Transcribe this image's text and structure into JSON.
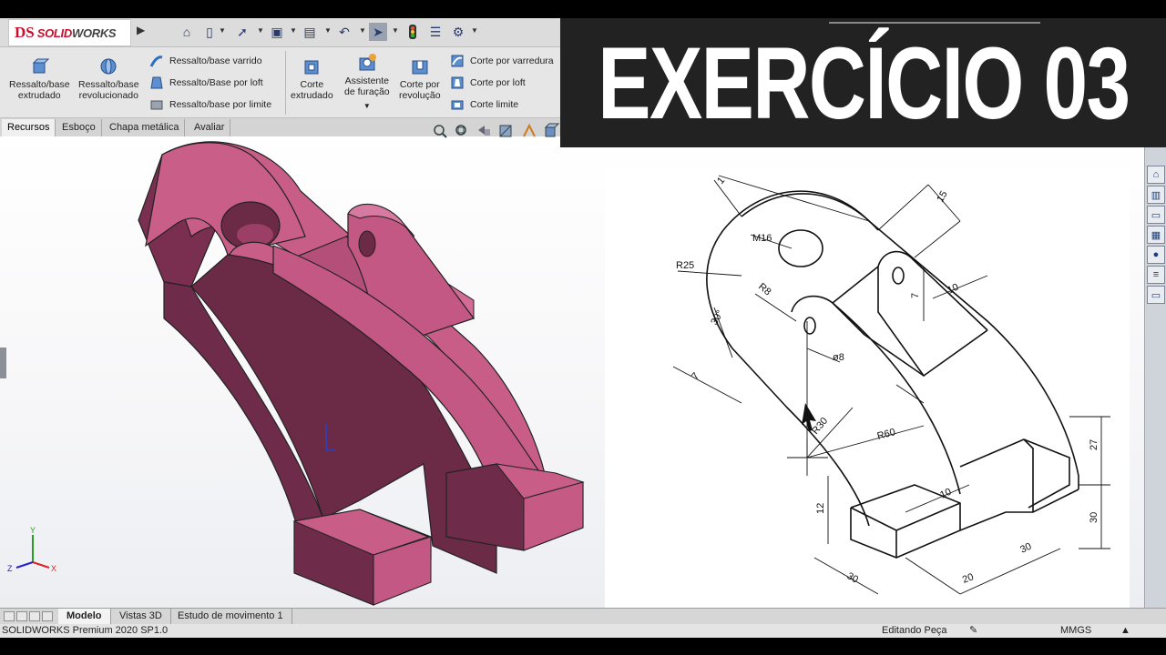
{
  "app": {
    "logo_prefix": "DS",
    "logo_brand": "SOLID",
    "logo_brand_bold": "WORKS"
  },
  "banner": {
    "title": "EXERCÍCIO 03"
  },
  "command_manager": {
    "buttons": [
      {
        "label_line1": "Ressalto/base",
        "label_line2": "extrudado"
      },
      {
        "label_line1": "Ressalto/base",
        "label_line2": "revolucionado"
      },
      {
        "label_line1": "Corte",
        "label_line2": "extrudado"
      },
      {
        "label_line1": "Assistente",
        "label_line2": "de furação"
      },
      {
        "label_line1": "Corte por",
        "label_line2": "revolução"
      }
    ],
    "small_buttons": [
      "Ressalto/base varrido",
      "Ressalto/Base por loft",
      "Ressalto/base por limite",
      "Corte por varredura",
      "Corte por loft",
      "Corte limite"
    ]
  },
  "tabs": [
    "Recursos",
    "Esboço",
    "Chapa metálica",
    "Avaliar"
  ],
  "bottom_tabs": [
    "Modelo",
    "Vistas 3D",
    "Estudo de movimento 1"
  ],
  "status": {
    "product": "SOLIDWORKS Premium 2020 SP1.0",
    "mode": "Editando Peça",
    "units": "MMGS"
  },
  "triad": {
    "x": "X",
    "y": "Y",
    "z": "Z"
  },
  "drawing_labels": {
    "m16": "M16",
    "r25": "R25",
    "r8": "R8",
    "ang30": "30°",
    "d8": "ø8",
    "r30": "R30",
    "r60": "R60",
    "d15": "15",
    "d10a": "10",
    "d7": "7",
    "d1": "1",
    "d1b": "7",
    "d27": "27",
    "d30v": "30",
    "d12": "12",
    "d10b": "10",
    "d30a": "30",
    "d20": "20",
    "d30b": "30"
  },
  "colors": {
    "part_light": "#c85d87",
    "part_mid": "#a8466e",
    "part_dark": "#6b2a45",
    "brand_red": "#c8102e"
  }
}
